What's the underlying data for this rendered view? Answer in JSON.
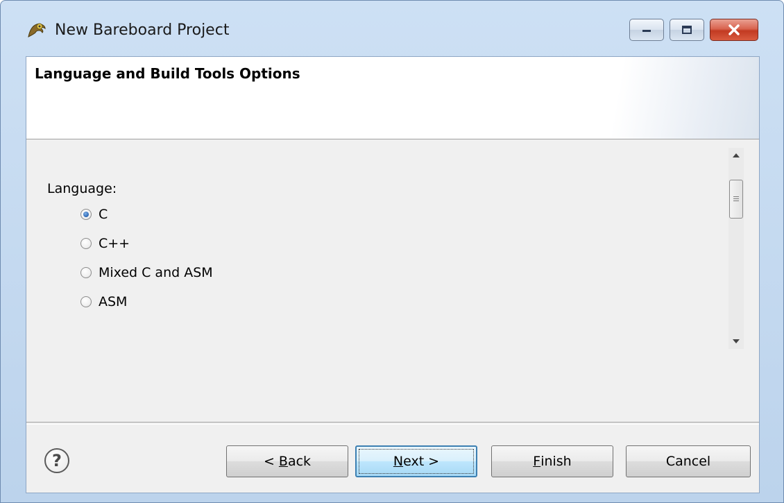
{
  "window": {
    "title": "New Bareboard Project"
  },
  "header": {
    "title": "Language and Build Tools Options"
  },
  "language": {
    "label": "Language:",
    "options": [
      {
        "label": "C",
        "selected": true
      },
      {
        "label": "C++",
        "selected": false
      },
      {
        "label": "Mixed C and ASM",
        "selected": false
      },
      {
        "label": "ASM",
        "selected": false
      }
    ]
  },
  "buttons": {
    "back_prefix": "< ",
    "back_mnemonic": "B",
    "back_rest": "ack",
    "next_mnemonic": "N",
    "next_rest": "ext >",
    "finish_mnemonic": "F",
    "finish_rest": "inish",
    "cancel": "Cancel"
  },
  "help": {
    "glyph": "?"
  },
  "colors": {
    "accent": "#3c7fb1",
    "close_button": "#c23a22"
  }
}
